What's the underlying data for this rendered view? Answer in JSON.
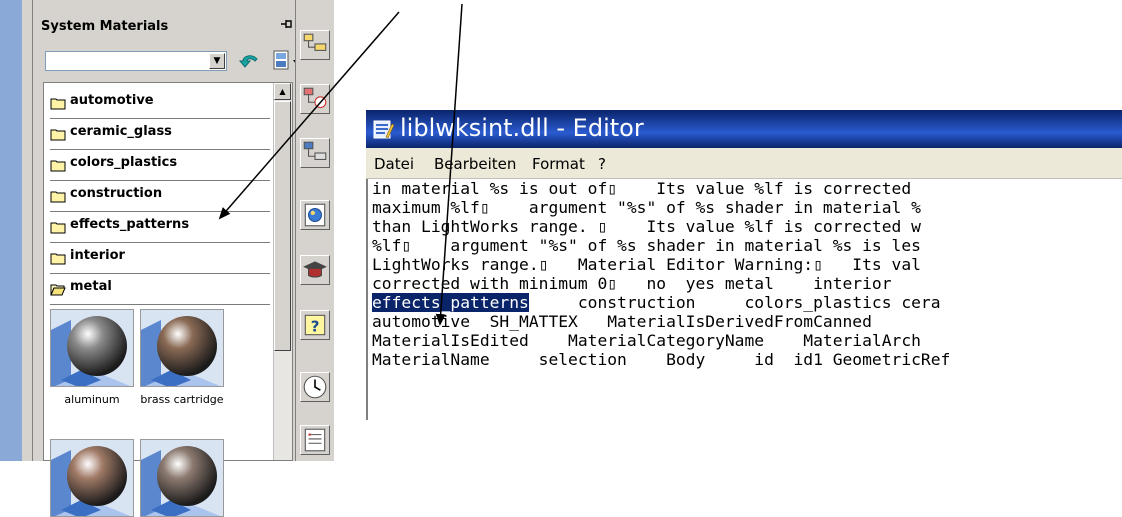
{
  "palette": {
    "title": "System Materials",
    "filter_value": "",
    "folders": [
      {
        "label": "automotive",
        "open": false
      },
      {
        "label": "ceramic_glass",
        "open": false
      },
      {
        "label": "colors_plastics",
        "open": false
      },
      {
        "label": "construction",
        "open": false
      },
      {
        "label": "effects_patterns",
        "open": false
      },
      {
        "label": "interior",
        "open": false
      },
      {
        "label": "metal",
        "open": true
      }
    ],
    "thumbnails": [
      {
        "label": "aluminum",
        "sphere_color": "#8a8a8a"
      },
      {
        "label": "brass cartridge",
        "sphere_color": "#8a6a55"
      },
      {
        "label": "",
        "sphere_color": "#a07a66"
      },
      {
        "label": "",
        "sphere_color": "#8c7a70"
      }
    ]
  },
  "tools": [
    {
      "icon": "hierarchy-tree-icon"
    },
    {
      "icon": "material-assign-icon"
    },
    {
      "icon": "material-tree-icon"
    },
    {
      "icon": "globe-render-icon"
    },
    {
      "icon": "graduation-cap-icon"
    },
    {
      "icon": "help-icon"
    },
    {
      "icon": "clock-icon"
    },
    {
      "icon": "list-view-icon"
    }
  ],
  "editor": {
    "title": "liblwksint.dll - Editor",
    "menu": [
      "Datei",
      "Bearbeiten",
      "Format",
      "?"
    ],
    "lines": [
      {
        "pre": "in material %s is out of▯    Its value %lf is corrected"
      },
      {
        "pre": "maximum %lf▯    argument \"%s\" of %s shader in material %"
      },
      {
        "pre": "than LightWorks range. ▯    Its value %lf is corrected w"
      },
      {
        "pre": "%lf▯    argument \"%s\" of %s shader in material %s is les"
      },
      {
        "pre": "LightWorks range.▯   Material Editor Warning:▯   Its val"
      },
      {
        "pre": "corrected with minimum 0▯   no  yes metal    interior"
      },
      {
        "hl": "effects_patterns",
        "post": "     construction     colors_plastics cera"
      },
      {
        "pre": "automotive  SH_MATTEX   MaterialIsDerivedFromCanned"
      },
      {
        "pre": "MaterialIsEdited    MaterialCategoryName    MaterialArch"
      },
      {
        "pre": "MaterialName     selection    Body     id  id1 GeometricRef"
      }
    ]
  },
  "colors": {
    "selection_bg": "#0a246a",
    "titlebar": "#0a246a",
    "panel": "#d6d3ce"
  }
}
